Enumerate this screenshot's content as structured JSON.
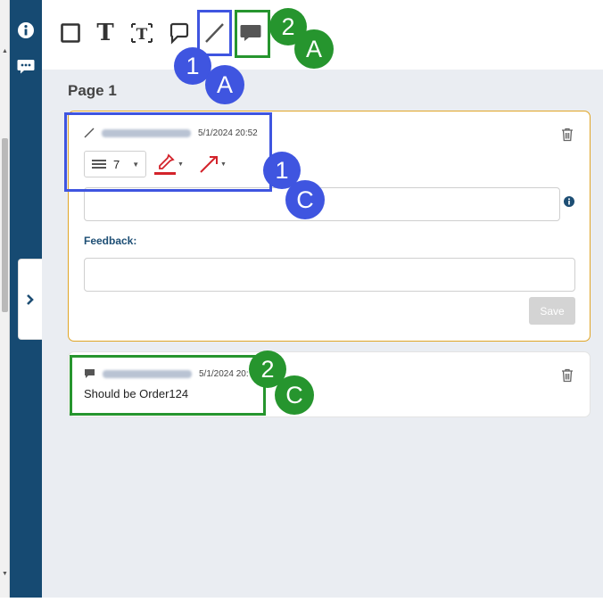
{
  "toolbar": {
    "tools": [
      {
        "name": "rectangle-tool"
      },
      {
        "name": "text-tool",
        "glyph": "T"
      },
      {
        "name": "textbox-tool",
        "glyph": "T"
      },
      {
        "name": "callout-tool"
      },
      {
        "name": "line-tool"
      },
      {
        "name": "comment-tool"
      }
    ]
  },
  "sidebar": {
    "icons": [
      "info-icon",
      "comment-bubble-icon"
    ],
    "collapse_icon": "chevron-right-icon"
  },
  "page": {
    "title": "Page 1"
  },
  "annotation_card": {
    "type_icon": "line-icon",
    "date": "5/1/2024 20:52",
    "line_width": "7",
    "feedback_label": "Feedback:",
    "save_label": "Save"
  },
  "comment_card": {
    "type_icon": "comment-icon",
    "date": "5/1/2024 20:",
    "text": "Should be Order124"
  },
  "callouts": [
    {
      "label": "1",
      "color": "#3f55e0"
    },
    {
      "label": "A",
      "color": "#3f55e0"
    },
    {
      "label": "2",
      "color": "#26952e"
    },
    {
      "label": "A",
      "color": "#26952e"
    },
    {
      "label": "1",
      "color": "#3f55e0"
    },
    {
      "label": "C",
      "color": "#3f55e0"
    },
    {
      "label": "2",
      "color": "#26952e"
    },
    {
      "label": "C",
      "color": "#26952e"
    }
  ],
  "colors": {
    "sidebar": "#164a72",
    "active_border": "#e0a526",
    "accent_red": "#d3232b"
  }
}
